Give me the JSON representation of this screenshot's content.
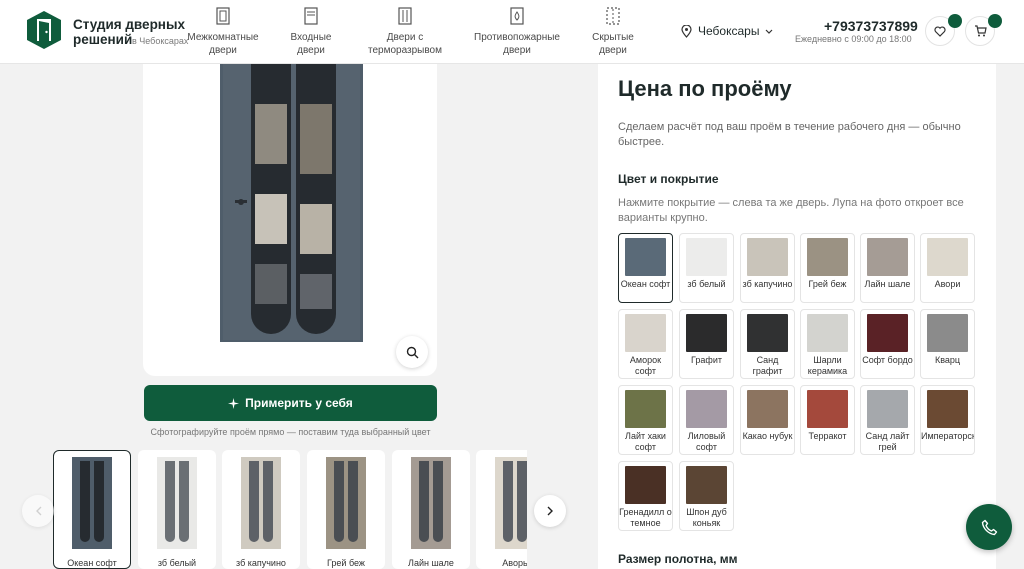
{
  "header": {
    "brand_name": "Студия дверных решений",
    "brand_city": "в Чебоксарах",
    "nav": [
      {
        "label": "Межкомнатные двери",
        "icon": "door-interior-icon"
      },
      {
        "label": "Входные двери",
        "icon": "door-entrance-icon"
      },
      {
        "label": "Двери с терморазрывом",
        "icon": "door-thermal-icon"
      },
      {
        "label": "Противопожарные двери",
        "icon": "door-fire-icon"
      },
      {
        "label": "Скрытые двери",
        "icon": "door-hidden-icon"
      }
    ],
    "city": "Чебоксары",
    "phone": "+79373737899",
    "hours": "Ежедневно с 09:00 до 18:00"
  },
  "product": {
    "try_label": "Примерить у себя",
    "try_hint": "Сфотографируйте проём прямо — поставим туда выбранный цвет"
  },
  "thumbs": [
    {
      "label": "Океан софт",
      "color": "#4f5d6a"
    },
    {
      "label": "зб белый",
      "color": "#e9e9e7"
    },
    {
      "label": "зб капучино",
      "color": "#cfcac0"
    },
    {
      "label": "Грей беж",
      "color": "#9c9384"
    },
    {
      "label": "Лайн шале",
      "color": "#a49b93"
    },
    {
      "label": "Аворь",
      "color": "#ddd7cc"
    }
  ],
  "panel": {
    "title": "Цена по проёму",
    "subtitle": "Сделаем расчёт под ваш проём в течение рабочего дня — обычно быстрее.",
    "color_title": "Цвет и покрытие",
    "color_hint": "Нажмите покрытие — слева та же дверь. Лупа на фото откроет все варианты крупно.",
    "size_title": "Размер полотна, мм"
  },
  "swatches": [
    {
      "label": "Океан софт",
      "color": "#5a6a78"
    },
    {
      "label": "зб белый",
      "color": "#ececeb"
    },
    {
      "label": "зб капучино",
      "color": "#c9c4ba"
    },
    {
      "label": "Грей беж",
      "color": "#9b9283"
    },
    {
      "label": "Лайн шале",
      "color": "#a59c95"
    },
    {
      "label": "Авори",
      "color": "#ddd8cd"
    },
    {
      "label": "Аморок софт",
      "color": "#d9d4cc"
    },
    {
      "label": "Графит",
      "color": "#2b2b2c"
    },
    {
      "label": "Санд графит",
      "color": "#303132"
    },
    {
      "label": "Шарли керамика",
      "color": "#d3d3cf"
    },
    {
      "label": "Софт бордо",
      "color": "#5a2226"
    },
    {
      "label": "Кварц",
      "color": "#8b8b8b"
    },
    {
      "label": "Лайт хаки софт",
      "color": "#6d7348"
    },
    {
      "label": "Лиловый софт",
      "color": "#a49aa5"
    },
    {
      "label": "Какао нубук",
      "color": "#8c7460"
    },
    {
      "label": "Терракот",
      "color": "#a4493c"
    },
    {
      "label": "Санд лайт грей",
      "color": "#a5a8ac"
    },
    {
      "label": "Императорское...",
      "color": "#6b4a33"
    },
    {
      "label": "Гренадилл о темное",
      "color": "#4a3025"
    },
    {
      "label": "Шпон дуб коньяк",
      "color": "#5b4534"
    }
  ]
}
